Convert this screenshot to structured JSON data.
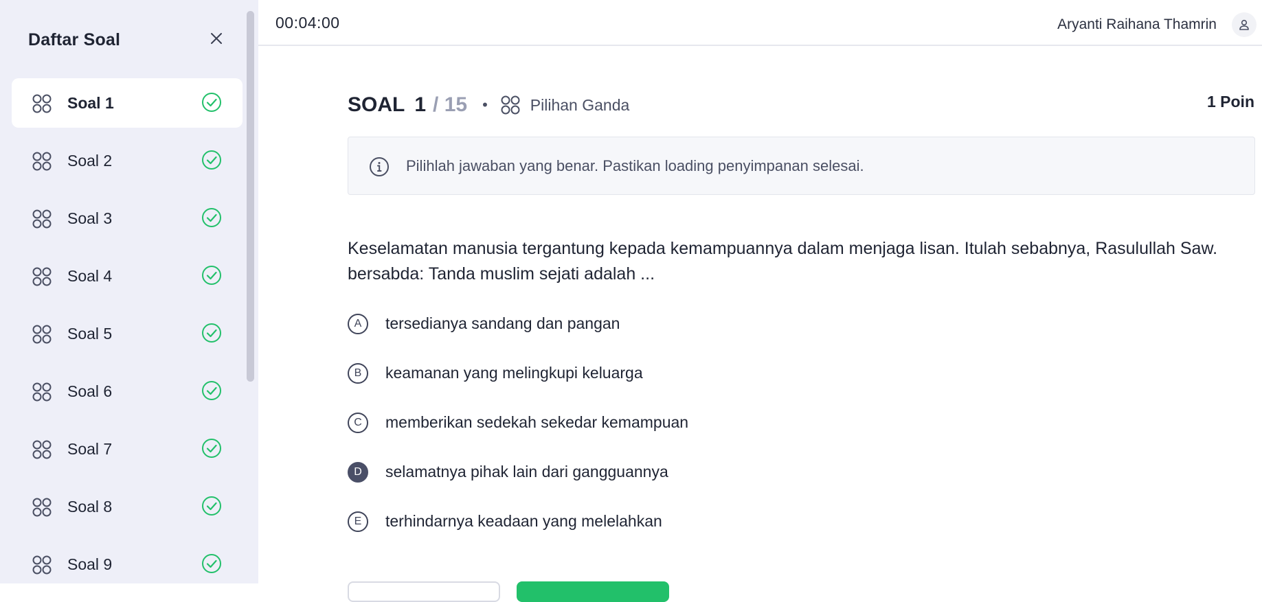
{
  "sidebar": {
    "title": "Daftar Soal",
    "items": [
      {
        "label": "Soal 1",
        "active": true,
        "answered": true
      },
      {
        "label": "Soal 2",
        "active": false,
        "answered": true
      },
      {
        "label": "Soal 3",
        "active": false,
        "answered": true
      },
      {
        "label": "Soal 4",
        "active": false,
        "answered": true
      },
      {
        "label": "Soal 5",
        "active": false,
        "answered": true
      },
      {
        "label": "Soal 6",
        "active": false,
        "answered": true
      },
      {
        "label": "Soal 7",
        "active": false,
        "answered": true
      },
      {
        "label": "Soal 8",
        "active": false,
        "answered": true
      },
      {
        "label": "Soal 9",
        "active": false,
        "answered": true
      }
    ]
  },
  "topbar": {
    "timer": "00:04:00",
    "username": "Aryanti Raihana Thamrin"
  },
  "question": {
    "word": "SOAL",
    "number": "1",
    "total": "/ 15",
    "separator": "•",
    "type": "Pilihan Ganda",
    "points": "1 Poin",
    "instruction": "Pilihlah jawaban yang benar. Pastikan loading penyimpanan selesai.",
    "text": "Keselamatan manusia tergantung kepada kemampuannya dalam menjaga lisan. Itulah sebabnya, Rasulullah Saw. bersabda: Tanda muslim sejati adalah ...",
    "options": [
      {
        "letter": "A",
        "text": "tersedianya sandang dan pangan",
        "selected": false
      },
      {
        "letter": "B",
        "text": "keamanan yang melingkupi keluarga",
        "selected": false
      },
      {
        "letter": "C",
        "text": "memberikan sedekah sekedar kemampuan",
        "selected": false
      },
      {
        "letter": "D",
        "text": "selamatnya pihak lain dari gangguannya",
        "selected": true
      },
      {
        "letter": "E",
        "text": "terhindarnya keadaan yang melelahkan",
        "selected": false
      }
    ]
  },
  "colors": {
    "sidebar_bg": "#eeeff8",
    "accent_green": "#22c06a",
    "selected_option": "#4a4f67",
    "muted_text": "#9a9fb3"
  },
  "icons": {
    "close": "close-icon",
    "grid": "grid-icon",
    "check": "check-circle-icon",
    "info": "info-icon",
    "user": "user-icon"
  }
}
